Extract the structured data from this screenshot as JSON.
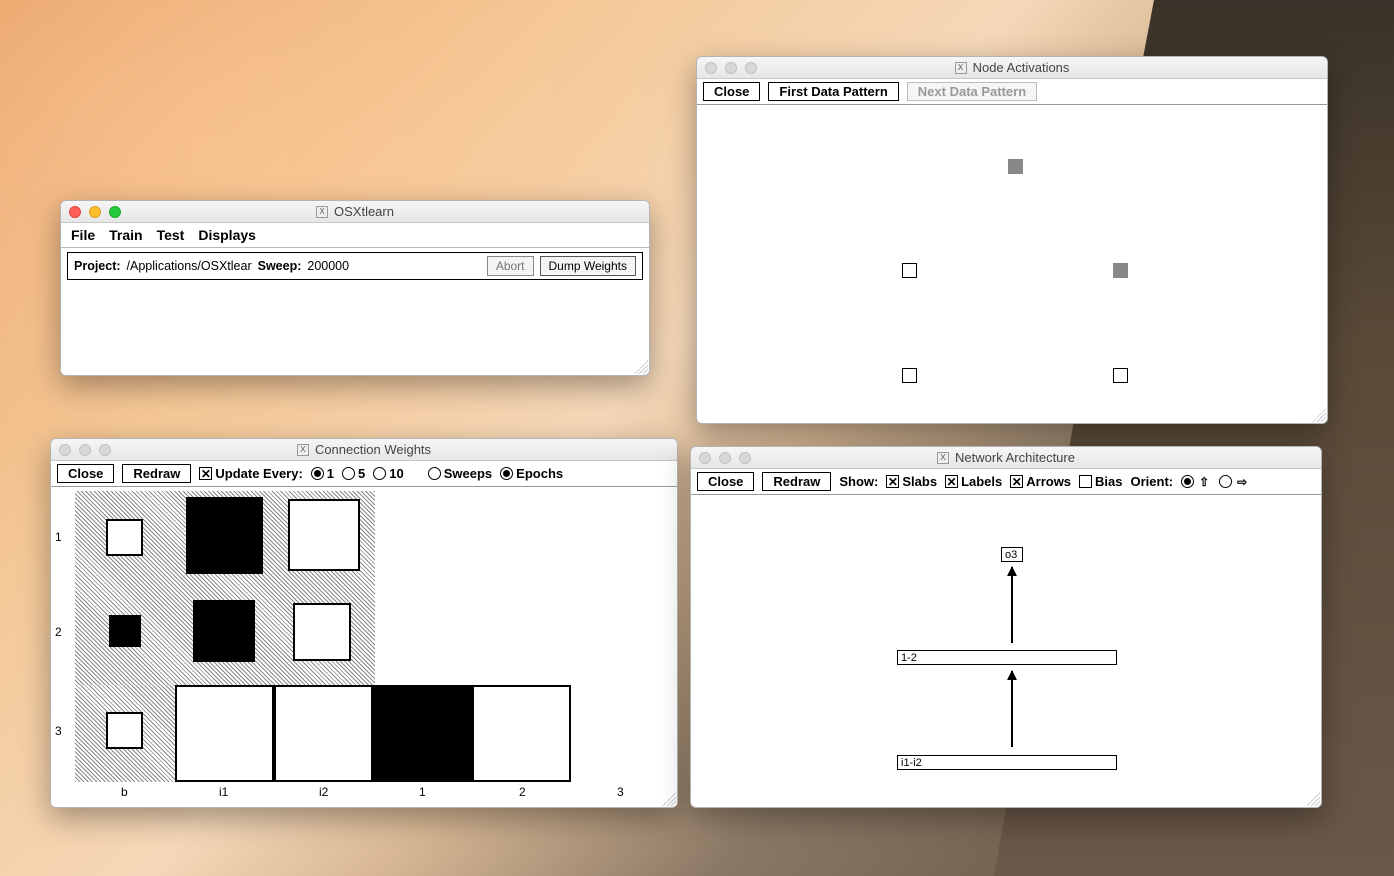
{
  "desktop": "macOS Yosemite",
  "windows": {
    "main": {
      "title": "OSXtlearn",
      "menu": [
        "File",
        "Train",
        "Test",
        "Displays"
      ],
      "project_label": "Project:",
      "project_path": "/Applications/OSXtlear",
      "sweep_label": "Sweep:",
      "sweep_value": "200000",
      "abort_btn": "Abort",
      "dump_btn": "Dump Weights"
    },
    "activations": {
      "title": "Node Activations",
      "close_btn": "Close",
      "first_btn": "First Data Pattern",
      "next_btn": "Next Data Pattern"
    },
    "weights": {
      "title": "Connection Weights",
      "close_btn": "Close",
      "redraw_btn": "Redraw",
      "update_label": "Update Every:",
      "update_options": [
        "1",
        "5",
        "10"
      ],
      "update_selected": "1",
      "mode_options": [
        "Sweeps",
        "Epochs"
      ],
      "mode_selected": "Epochs",
      "row_labels": [
        "1",
        "2",
        "3"
      ],
      "col_labels": [
        "b",
        "i1",
        "i2",
        "1",
        "2",
        "3"
      ]
    },
    "arch": {
      "title": "Network Architecture",
      "close_btn": "Close",
      "redraw_btn": "Redraw",
      "show_label": "Show:",
      "show_slabs": {
        "label": "Slabs",
        "checked": true
      },
      "show_labels": {
        "label": "Labels",
        "checked": true
      },
      "show_arrows": {
        "label": "Arrows",
        "checked": true
      },
      "show_bias": {
        "label": "Bias",
        "checked": false
      },
      "orient_label": "Orient:",
      "orient_selected": "up",
      "output_label": "o3",
      "hidden_label": "1-2",
      "input_label": "i1-i2"
    }
  }
}
